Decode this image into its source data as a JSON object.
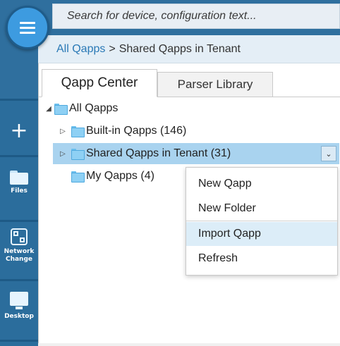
{
  "search": {
    "placeholder": "Search for device, configuration text..."
  },
  "breadcrumb": {
    "root": "All Qapps",
    "separator": ">",
    "current": "Shared Qapps in Tenant"
  },
  "rail": {
    "items": [
      {
        "label": "Files",
        "icon": "folder-icon"
      },
      {
        "label": "Network Change",
        "icon": "network-change-icon"
      },
      {
        "label": "Desktop",
        "icon": "desktop-icon"
      }
    ],
    "plus_icon": "+"
  },
  "tabs": [
    {
      "label": "Qapp Center",
      "active": true
    },
    {
      "label": "Parser Library",
      "active": false
    }
  ],
  "tree": {
    "root": {
      "label": "All Qapps",
      "expanded": true
    },
    "children": [
      {
        "label": "Built-in Qapps (146)",
        "expandable": true,
        "selected": false
      },
      {
        "label": "Shared Qapps in Tenant (31)",
        "expandable": true,
        "selected": true
      },
      {
        "label": "My Qapps (4)",
        "expandable": false,
        "selected": false
      }
    ]
  },
  "context_menu": {
    "items": [
      {
        "label": "New Qapp"
      },
      {
        "label": "New Folder"
      },
      {
        "label": "Import Qapp",
        "highlighted": true
      },
      {
        "label": "Refresh"
      }
    ]
  },
  "colors": {
    "rail": "#2b6d9c",
    "accent": "#3d9be0",
    "selection": "#a9d3ef",
    "link": "#2a79b6"
  }
}
